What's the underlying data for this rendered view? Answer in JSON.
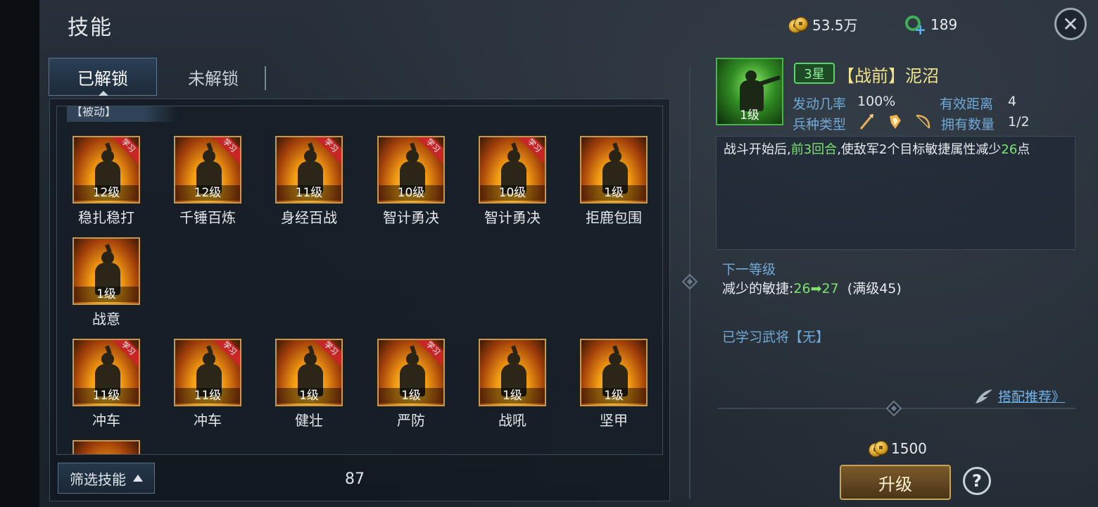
{
  "header": {
    "title": "技能",
    "copper": "53.5万",
    "jade": "189",
    "close_icon": "close-icon"
  },
  "tabs": [
    {
      "label": "已解锁",
      "active": true
    },
    {
      "label": "未解锁",
      "active": false
    }
  ],
  "list": {
    "section_tag": "【被动】",
    "learn_badge": "学习",
    "skills": [
      {
        "name": "稳扎稳打",
        "level": "12级",
        "learn": true
      },
      {
        "name": "千锤百炼",
        "level": "12级",
        "learn": true
      },
      {
        "name": "身经百战",
        "level": "11级",
        "learn": true
      },
      {
        "name": "智计勇决",
        "level": "10级",
        "learn": true
      },
      {
        "name": "智计勇决",
        "level": "10级",
        "learn": true
      },
      {
        "name": "拒鹿包围",
        "level": "1级",
        "learn": false
      },
      {
        "name": "战意",
        "level": "1级",
        "learn": false
      },
      {
        "name": "冲车",
        "level": "11级",
        "learn": true
      },
      {
        "name": "冲车",
        "level": "11级",
        "learn": true
      },
      {
        "name": "健壮",
        "level": "1级",
        "learn": true
      },
      {
        "name": "严防",
        "level": "1级",
        "learn": true
      },
      {
        "name": "战吼",
        "level": "1级",
        "learn": false
      },
      {
        "name": "坚甲",
        "level": "1级",
        "learn": false
      }
    ],
    "filter_label": "筛选技能",
    "count": "87"
  },
  "detail": {
    "icon_level": "1级",
    "star": "3星",
    "title": "【战前】泥沼",
    "trigger_label": "发动几率",
    "trigger_value": "100%",
    "range_label": "有效距离",
    "range_value": "4",
    "troop_label": "兵种类型",
    "troop_icons": [
      "spear-icon",
      "shield-icon",
      "bow-icon"
    ],
    "own_label": "拥有数量",
    "own_value": "1/2",
    "desc_a": "战斗开始后,",
    "desc_b": "前3回合",
    "desc_c": ",使敌军2个目标敏捷属性减少",
    "desc_d": "26",
    "desc_e": "点",
    "next_label": "下一等级",
    "next_prefix": "减少的敏捷:",
    "next_from": "26",
    "next_arrow": "➡",
    "next_to": "27",
    "next_max": "(满级45)",
    "learned_label": "已学习武将【无】",
    "recommend_label": "搭配推荐》",
    "cost": "1500",
    "upgrade_label": "升级",
    "help_label": "?"
  }
}
